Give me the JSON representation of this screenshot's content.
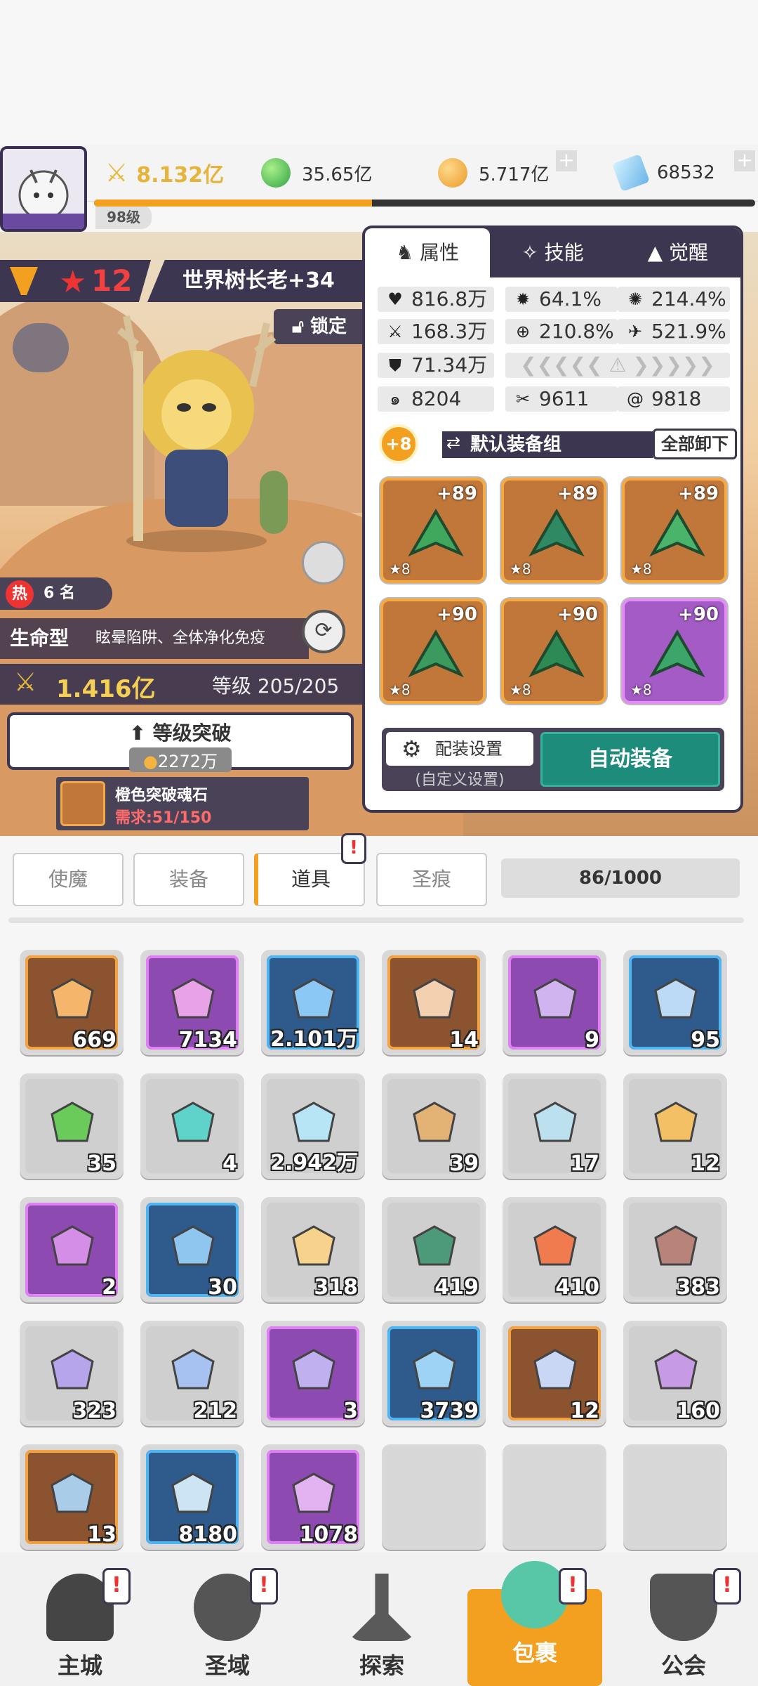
{
  "header": {
    "player_level": "98级",
    "power": "8.132亿",
    "green_currency": "35.65亿",
    "gold": "5.717亿",
    "diamonds": "68532",
    "xp_progress": 0.42
  },
  "hero": {
    "star_level": "12",
    "name": "世界树长老+34",
    "lock_label": "锁定",
    "hot_rank": "6 名",
    "type": "生命型",
    "traits": "眩晕陷阱、全体净化免疫",
    "power": "1.416亿",
    "level": "等级 205/205",
    "breakthrough_title": "等级突破",
    "breakthrough_cost": "2272万",
    "material_name": "橙色突破魂石",
    "material_req": "需求:51/150"
  },
  "panel": {
    "tabs": [
      "属性",
      "技能",
      "觉醒"
    ],
    "stats": {
      "hp": "816.8万",
      "crit": "64.1%",
      "crit_dmg": "214.4%",
      "atk": "168.3万",
      "acc": "210.8%",
      "speed": "521.9%",
      "def": "71.34万",
      "s1": "8204",
      "s2": "9611",
      "s3": "9818"
    },
    "equip_plus": "+8",
    "equip_set": "默认装备组",
    "unequip_all": "全部卸下",
    "equipment": [
      {
        "level": "+89",
        "stars": "★8",
        "rarity": "orange"
      },
      {
        "level": "+89",
        "stars": "★8",
        "rarity": "orange"
      },
      {
        "level": "+89",
        "stars": "★8",
        "rarity": "orange"
      },
      {
        "level": "+90",
        "stars": "★8",
        "rarity": "orange"
      },
      {
        "level": "+90",
        "stars": "★8",
        "rarity": "orange"
      },
      {
        "level": "+90",
        "stars": "★8",
        "rarity": "purple"
      }
    ],
    "config_label": "配装设置",
    "config_sub": "(自定义设置)",
    "auto_equip": "自动装备"
  },
  "inventory": {
    "categories": [
      "使魔",
      "装备",
      "道具",
      "圣痕"
    ],
    "active_category": "道具",
    "capacity": "86/1000",
    "items": [
      {
        "count": "669",
        "rarity": "orange",
        "color": "#f5b56a"
      },
      {
        "count": "7134",
        "rarity": "purple",
        "color": "#e8a2e8"
      },
      {
        "count": "2.101万",
        "rarity": "blue",
        "color": "#8cc8f5"
      },
      {
        "count": "14",
        "rarity": "orange",
        "color": "#f3d0b0"
      },
      {
        "count": "9",
        "rarity": "purple",
        "color": "#cfb4f0"
      },
      {
        "count": "95",
        "rarity": "blue",
        "color": "#bcd9f5"
      },
      {
        "count": "35",
        "rarity": "gray",
        "color": "#6acb5b"
      },
      {
        "count": "4",
        "rarity": "gray",
        "color": "#5fd2c9"
      },
      {
        "count": "2.942万",
        "rarity": "gray",
        "color": "#b7e5f5"
      },
      {
        "count": "39",
        "rarity": "gray",
        "color": "#e2b374"
      },
      {
        "count": "17",
        "rarity": "gray",
        "color": "#bde0ef"
      },
      {
        "count": "12",
        "rarity": "gray",
        "color": "#f3c066"
      },
      {
        "count": "2",
        "rarity": "purple",
        "color": "#d58ee8"
      },
      {
        "count": "30",
        "rarity": "blue",
        "color": "#8fc6f0"
      },
      {
        "count": "318",
        "rarity": "gray",
        "color": "#f6d28c"
      },
      {
        "count": "419",
        "rarity": "gray",
        "color": "#4d9a7a"
      },
      {
        "count": "410",
        "rarity": "gray",
        "color": "#f07b4f"
      },
      {
        "count": "383",
        "rarity": "gray",
        "color": "#b8847a"
      },
      {
        "count": "323",
        "rarity": "gray",
        "color": "#b6a5ea"
      },
      {
        "count": "212",
        "rarity": "gray",
        "color": "#a7c2f0"
      },
      {
        "count": "3",
        "rarity": "purple",
        "color": "#c0b0f0"
      },
      {
        "count": "3739",
        "rarity": "blue",
        "color": "#9fd3f5"
      },
      {
        "count": "12",
        "rarity": "orange",
        "color": "#c9d7f5"
      },
      {
        "count": "160",
        "rarity": "gray",
        "color": "#c79ae6"
      },
      {
        "count": "13",
        "rarity": "orange",
        "color": "#a9cde8"
      },
      {
        "count": "8180",
        "rarity": "blue",
        "color": "#cde4f5"
      },
      {
        "count": "1078",
        "rarity": "purple",
        "color": "#e2b3f0"
      },
      {
        "count": "",
        "rarity": "empty",
        "color": ""
      },
      {
        "count": "",
        "rarity": "empty",
        "color": ""
      },
      {
        "count": "",
        "rarity": "empty",
        "color": ""
      }
    ]
  },
  "nav": {
    "items": [
      "主城",
      "圣域",
      "探索",
      "包裹",
      "公会"
    ],
    "active": "包裹",
    "badge": "!"
  }
}
